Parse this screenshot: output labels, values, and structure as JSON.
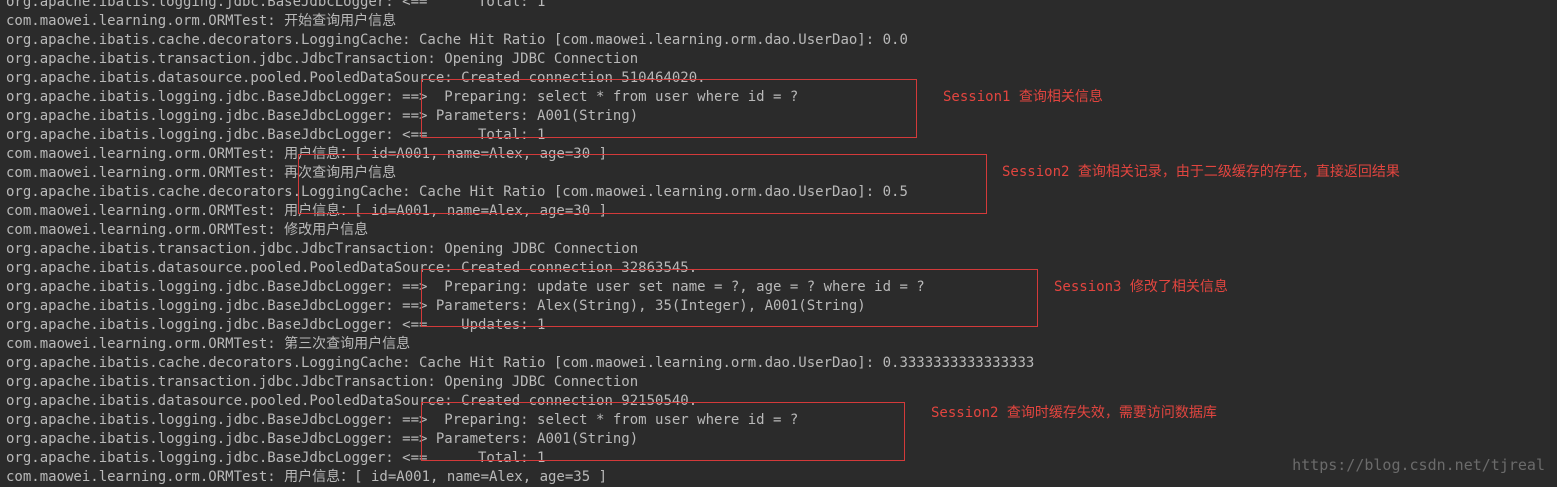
{
  "console": {
    "lines": [
      "org.apache.ibatis.logging.jdbc.BaseJdbcLogger: <==      Total: 1",
      "com.maowei.learning.orm.ORMTest: 开始查询用户信息",
      "org.apache.ibatis.cache.decorators.LoggingCache: Cache Hit Ratio [com.maowei.learning.orm.dao.UserDao]: 0.0",
      "org.apache.ibatis.transaction.jdbc.JdbcTransaction: Opening JDBC Connection",
      "org.apache.ibatis.datasource.pooled.PooledDataSource: Created connection 510464020.",
      "org.apache.ibatis.logging.jdbc.BaseJdbcLogger: ==>  Preparing: select * from user where id = ?",
      "org.apache.ibatis.logging.jdbc.BaseJdbcLogger: ==> Parameters: A001(String)",
      "org.apache.ibatis.logging.jdbc.BaseJdbcLogger: <==      Total: 1",
      "com.maowei.learning.orm.ORMTest: 用户信息：[ id=A001, name=Alex, age=30 ]",
      "com.maowei.learning.orm.ORMTest: 再次查询用户信息",
      "org.apache.ibatis.cache.decorators.LoggingCache: Cache Hit Ratio [com.maowei.learning.orm.dao.UserDao]: 0.5",
      "com.maowei.learning.orm.ORMTest: 用户信息：[ id=A001, name=Alex, age=30 ]",
      "com.maowei.learning.orm.ORMTest: 修改用户信息",
      "org.apache.ibatis.transaction.jdbc.JdbcTransaction: Opening JDBC Connection",
      "org.apache.ibatis.datasource.pooled.PooledDataSource: Created connection 32863545.",
      "org.apache.ibatis.logging.jdbc.BaseJdbcLogger: ==>  Preparing: update user set name = ?, age = ? where id = ?",
      "org.apache.ibatis.logging.jdbc.BaseJdbcLogger: ==> Parameters: Alex(String), 35(Integer), A001(String)",
      "org.apache.ibatis.logging.jdbc.BaseJdbcLogger: <==    Updates: 1",
      "com.maowei.learning.orm.ORMTest: 第三次查询用户信息",
      "org.apache.ibatis.cache.decorators.LoggingCache: Cache Hit Ratio [com.maowei.learning.orm.dao.UserDao]: 0.3333333333333333",
      "org.apache.ibatis.transaction.jdbc.JdbcTransaction: Opening JDBC Connection",
      "org.apache.ibatis.datasource.pooled.PooledDataSource: Created connection 92150540.",
      "org.apache.ibatis.logging.jdbc.BaseJdbcLogger: ==>  Preparing: select * from user where id = ?",
      "org.apache.ibatis.logging.jdbc.BaseJdbcLogger: ==> Parameters: A001(String)",
      "org.apache.ibatis.logging.jdbc.BaseJdbcLogger: <==      Total: 1",
      "com.maowei.learning.orm.ORMTest: 用户信息：[ id=A001, name=Alex, age=35 ]"
    ]
  },
  "annotations": {
    "session1": "Session1 查询相关信息",
    "session2_hit": "Session2 查询相关记录，由于二级缓存的存在，直接返回结果",
    "session3": "Session3 修改了相关信息",
    "session2_miss": "Session2 查询时缓存失效，需要访问数据库"
  },
  "colors": {
    "background": "#2b2b2b",
    "text": "#b9b9b9",
    "highlight": "#d33a3a"
  },
  "watermark": "https://blog.csdn.net/tjreal"
}
